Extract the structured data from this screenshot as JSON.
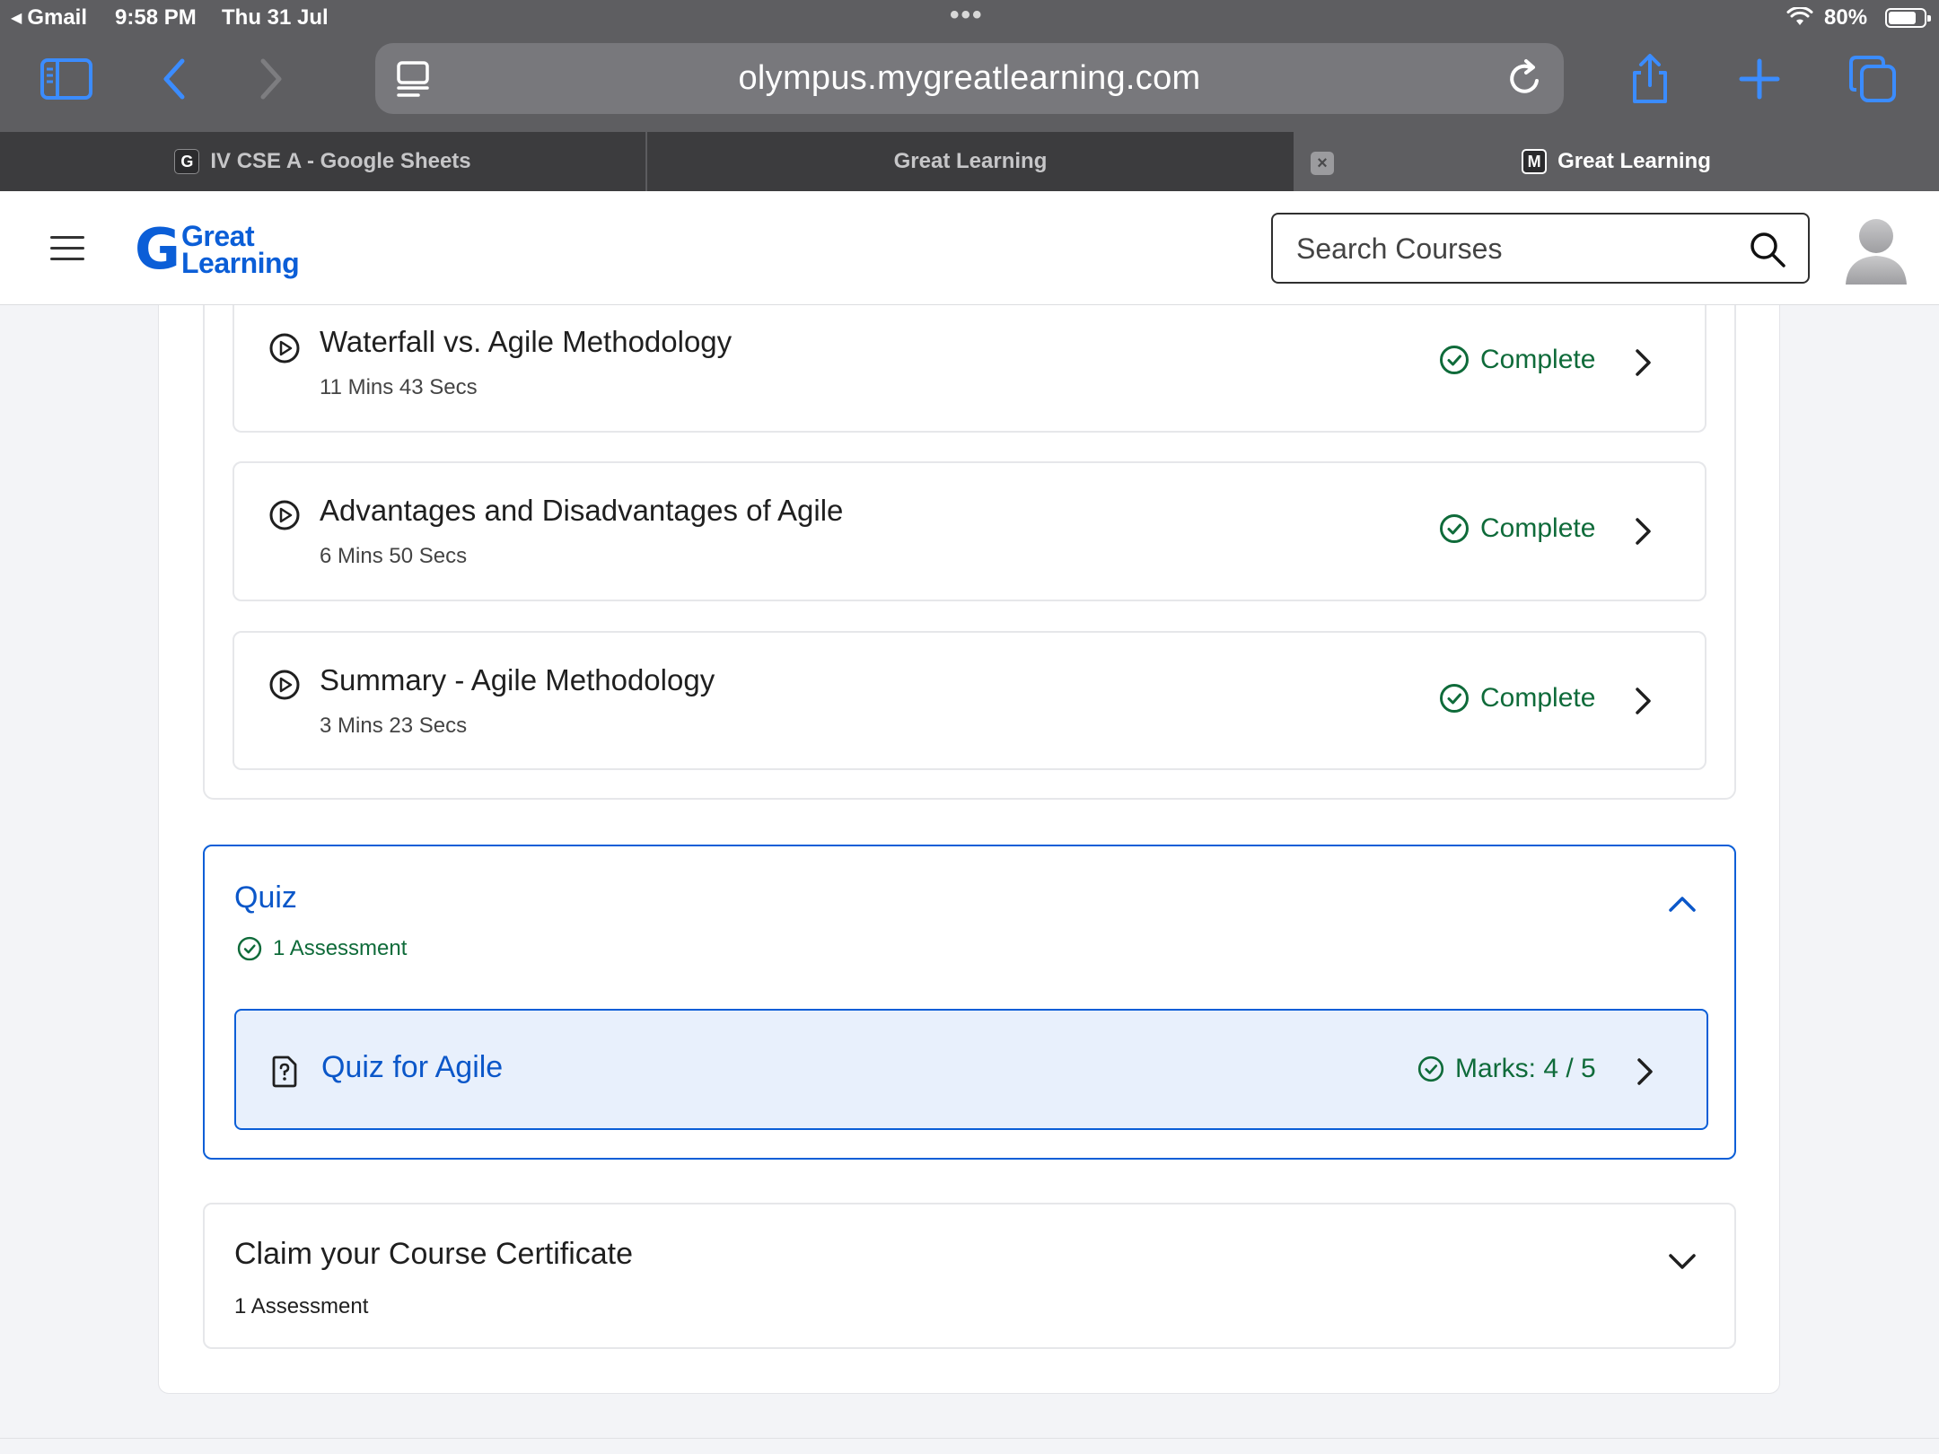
{
  "status_bar": {
    "back_app": "Gmail",
    "time": "9:58 PM",
    "date": "Thu 31 Jul",
    "dots": "•••",
    "battery": "80%",
    "battery_level": 0.8
  },
  "browser": {
    "url": "olympus.mygreatlearning.com",
    "tabs": [
      {
        "favicon": "G",
        "label": "IV CSE A - Google Sheets"
      },
      {
        "favicon": "",
        "label": "Great Learning"
      },
      {
        "favicon": "M",
        "label": "Great Learning",
        "active": true
      }
    ],
    "close_glyph": "×",
    "accent_color": "#2f7cf6"
  },
  "header": {
    "logo_mark": "G",
    "logo_line1": "Great",
    "logo_line2": "Learning",
    "search_placeholder": "Search Courses",
    "brand_color": "#0b5ed7"
  },
  "lessons": [
    {
      "title": "Waterfall vs. Agile Methodology",
      "duration": "11 Mins 43 Secs",
      "status": "Complete",
      "icon": "play-circle-icon"
    },
    {
      "title": "Advantages and Disadvantages of Agile",
      "duration": "6 Mins 50 Secs",
      "status": "Complete",
      "icon": "play-circle-icon"
    },
    {
      "title": "Summary - Agile Methodology",
      "duration": "3 Mins 23 Secs",
      "status": "Complete",
      "icon": "play-circle-icon"
    }
  ],
  "quiz": {
    "title": "Quiz",
    "count": "1 Assessment",
    "expanded": true,
    "item": {
      "title": "Quiz for Agile",
      "marks": "Marks: 4 / 5",
      "icon": "quiz-document-icon"
    }
  },
  "certificate": {
    "title": "Claim your Course Certificate",
    "count": "1 Assessment",
    "expanded": false
  },
  "colors": {
    "complete_green": "#0f6b3a",
    "link_blue": "#0b57c9",
    "quiz_highlight_bg": "#e8f0fc"
  }
}
